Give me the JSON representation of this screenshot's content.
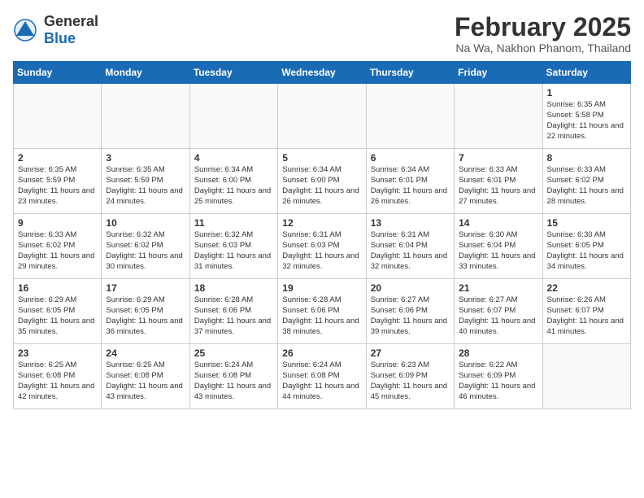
{
  "header": {
    "logo_general": "General",
    "logo_blue": "Blue",
    "month_title": "February 2025",
    "location": "Na Wa, Nakhon Phanom, Thailand"
  },
  "weekdays": [
    "Sunday",
    "Monday",
    "Tuesday",
    "Wednesday",
    "Thursday",
    "Friday",
    "Saturday"
  ],
  "weeks": [
    [
      {
        "day": "",
        "text": ""
      },
      {
        "day": "",
        "text": ""
      },
      {
        "day": "",
        "text": ""
      },
      {
        "day": "",
        "text": ""
      },
      {
        "day": "",
        "text": ""
      },
      {
        "day": "",
        "text": ""
      },
      {
        "day": "1",
        "text": "Sunrise: 6:35 AM\nSunset: 5:58 PM\nDaylight: 11 hours and 22 minutes."
      }
    ],
    [
      {
        "day": "2",
        "text": "Sunrise: 6:35 AM\nSunset: 5:59 PM\nDaylight: 11 hours and 23 minutes."
      },
      {
        "day": "3",
        "text": "Sunrise: 6:35 AM\nSunset: 5:59 PM\nDaylight: 11 hours and 24 minutes."
      },
      {
        "day": "4",
        "text": "Sunrise: 6:34 AM\nSunset: 6:00 PM\nDaylight: 11 hours and 25 minutes."
      },
      {
        "day": "5",
        "text": "Sunrise: 6:34 AM\nSunset: 6:00 PM\nDaylight: 11 hours and 26 minutes."
      },
      {
        "day": "6",
        "text": "Sunrise: 6:34 AM\nSunset: 6:01 PM\nDaylight: 11 hours and 26 minutes."
      },
      {
        "day": "7",
        "text": "Sunrise: 6:33 AM\nSunset: 6:01 PM\nDaylight: 11 hours and 27 minutes."
      },
      {
        "day": "8",
        "text": "Sunrise: 6:33 AM\nSunset: 6:02 PM\nDaylight: 11 hours and 28 minutes."
      }
    ],
    [
      {
        "day": "9",
        "text": "Sunrise: 6:33 AM\nSunset: 6:02 PM\nDaylight: 11 hours and 29 minutes."
      },
      {
        "day": "10",
        "text": "Sunrise: 6:32 AM\nSunset: 6:02 PM\nDaylight: 11 hours and 30 minutes."
      },
      {
        "day": "11",
        "text": "Sunrise: 6:32 AM\nSunset: 6:03 PM\nDaylight: 11 hours and 31 minutes."
      },
      {
        "day": "12",
        "text": "Sunrise: 6:31 AM\nSunset: 6:03 PM\nDaylight: 11 hours and 32 minutes."
      },
      {
        "day": "13",
        "text": "Sunrise: 6:31 AM\nSunset: 6:04 PM\nDaylight: 11 hours and 32 minutes."
      },
      {
        "day": "14",
        "text": "Sunrise: 6:30 AM\nSunset: 6:04 PM\nDaylight: 11 hours and 33 minutes."
      },
      {
        "day": "15",
        "text": "Sunrise: 6:30 AM\nSunset: 6:05 PM\nDaylight: 11 hours and 34 minutes."
      }
    ],
    [
      {
        "day": "16",
        "text": "Sunrise: 6:29 AM\nSunset: 6:05 PM\nDaylight: 11 hours and 35 minutes."
      },
      {
        "day": "17",
        "text": "Sunrise: 6:29 AM\nSunset: 6:05 PM\nDaylight: 11 hours and 36 minutes."
      },
      {
        "day": "18",
        "text": "Sunrise: 6:28 AM\nSunset: 6:06 PM\nDaylight: 11 hours and 37 minutes."
      },
      {
        "day": "19",
        "text": "Sunrise: 6:28 AM\nSunset: 6:06 PM\nDaylight: 11 hours and 38 minutes."
      },
      {
        "day": "20",
        "text": "Sunrise: 6:27 AM\nSunset: 6:06 PM\nDaylight: 11 hours and 39 minutes."
      },
      {
        "day": "21",
        "text": "Sunrise: 6:27 AM\nSunset: 6:07 PM\nDaylight: 11 hours and 40 minutes."
      },
      {
        "day": "22",
        "text": "Sunrise: 6:26 AM\nSunset: 6:07 PM\nDaylight: 11 hours and 41 minutes."
      }
    ],
    [
      {
        "day": "23",
        "text": "Sunrise: 6:25 AM\nSunset: 6:08 PM\nDaylight: 11 hours and 42 minutes."
      },
      {
        "day": "24",
        "text": "Sunrise: 6:25 AM\nSunset: 6:08 PM\nDaylight: 11 hours and 43 minutes."
      },
      {
        "day": "25",
        "text": "Sunrise: 6:24 AM\nSunset: 6:08 PM\nDaylight: 11 hours and 43 minutes."
      },
      {
        "day": "26",
        "text": "Sunrise: 6:24 AM\nSunset: 6:08 PM\nDaylight: 11 hours and 44 minutes."
      },
      {
        "day": "27",
        "text": "Sunrise: 6:23 AM\nSunset: 6:09 PM\nDaylight: 11 hours and 45 minutes."
      },
      {
        "day": "28",
        "text": "Sunrise: 6:22 AM\nSunset: 6:09 PM\nDaylight: 11 hours and 46 minutes."
      },
      {
        "day": "",
        "text": ""
      }
    ]
  ]
}
